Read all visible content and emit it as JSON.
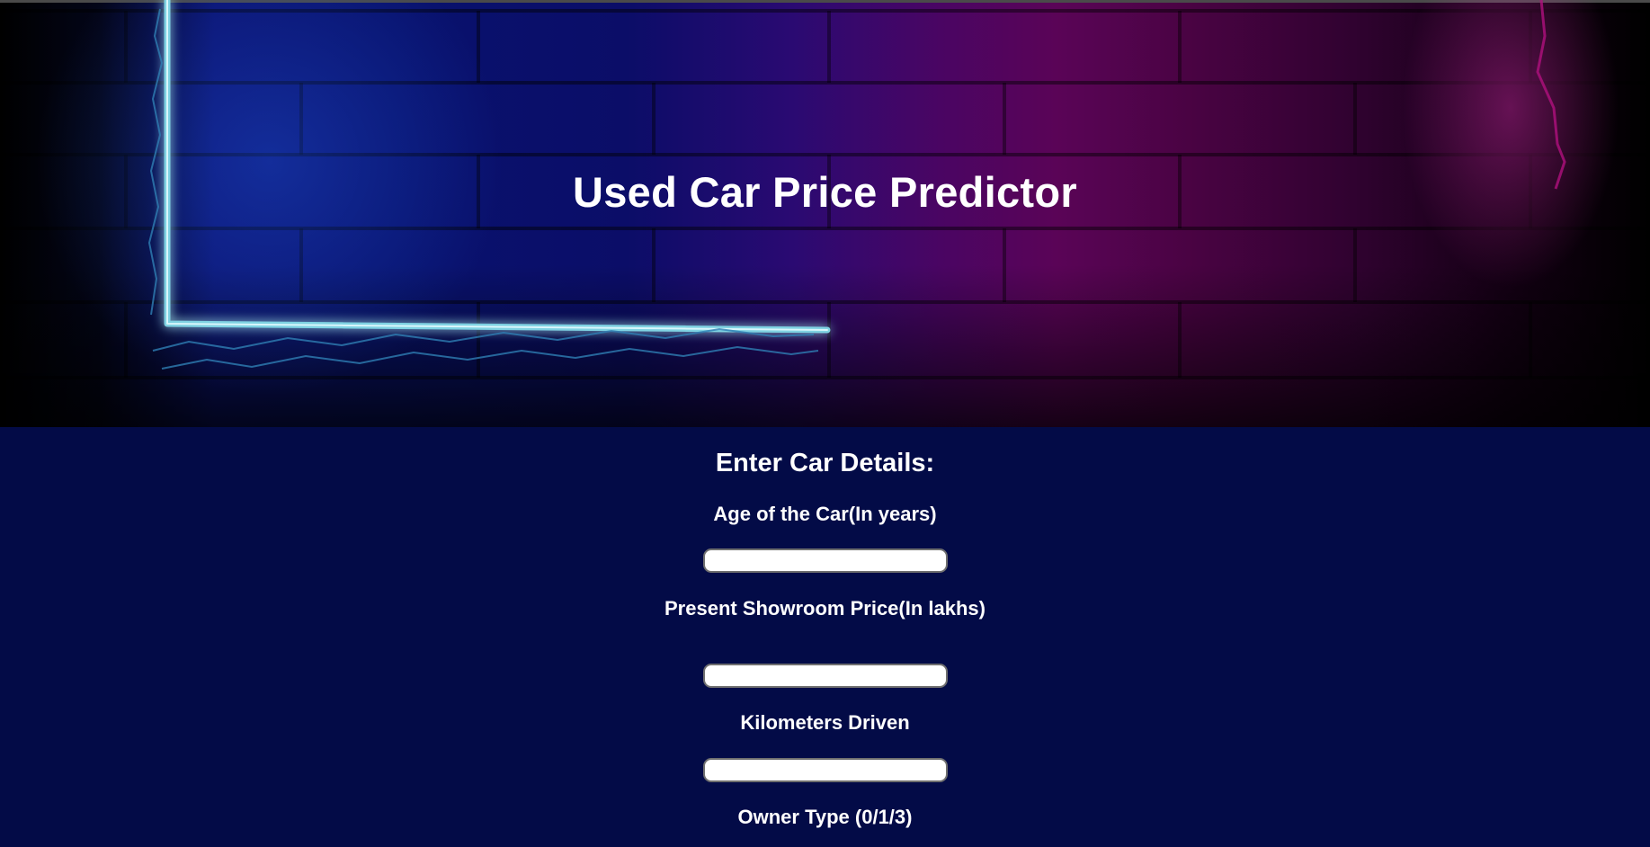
{
  "hero": {
    "title": "Used Car Price Predictor"
  },
  "form": {
    "heading": "Enter Car Details:",
    "fields": [
      {
        "label": "Age of the Car(In years)",
        "value": "",
        "placeholder": ""
      },
      {
        "label": "Present Showroom Price(In lakhs)",
        "value": "",
        "placeholder": ""
      },
      {
        "label": "Kilometers Driven",
        "value": "",
        "placeholder": ""
      },
      {
        "label": "Owner Type (0/1/3)"
      }
    ]
  },
  "colors": {
    "page_background": "#030b47",
    "hero_blue": "#08126e",
    "hero_magenta": "#5a0457",
    "neon_cyan": "#8fd8e6",
    "neon_pink": "#ff4fd8",
    "text": "#ffffff",
    "input_background": "#ffffff",
    "input_border": "#6f6f6f"
  }
}
